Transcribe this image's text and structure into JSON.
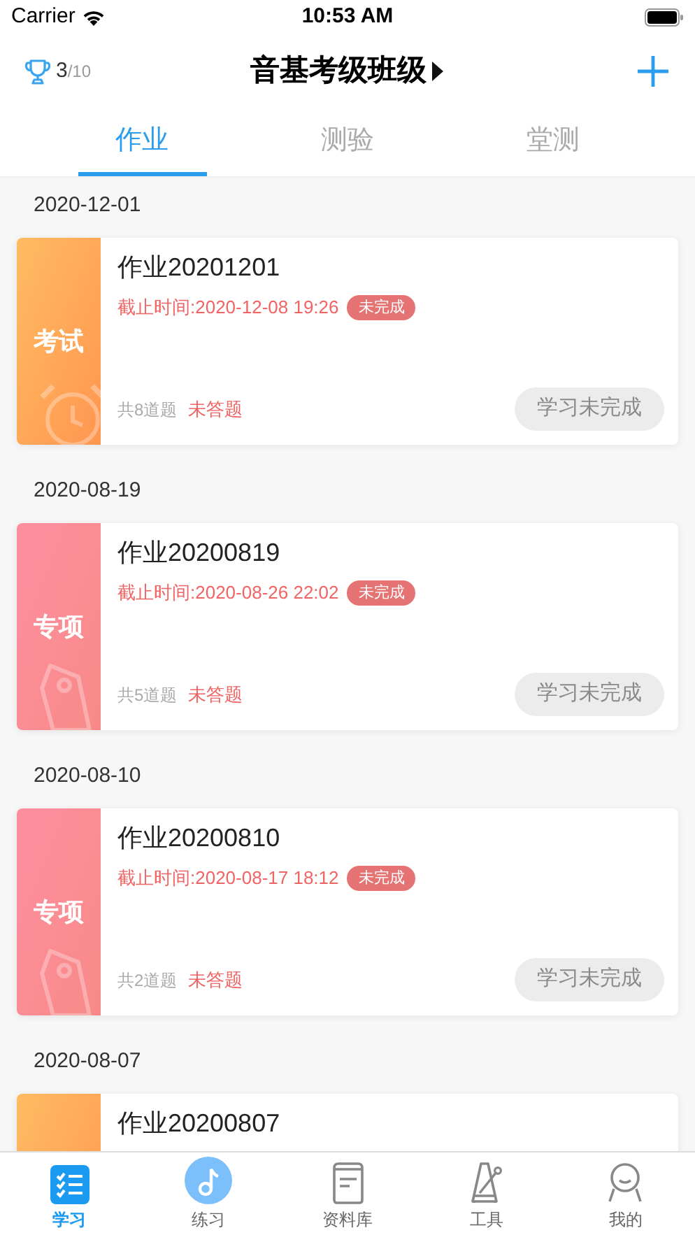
{
  "status_bar": {
    "carrier": "Carrier",
    "time": "10:53 AM"
  },
  "header": {
    "score": "3",
    "score_total": "/10",
    "title": "音基考级班级"
  },
  "tabs": [
    {
      "label": "作业",
      "selected": true
    },
    {
      "label": "测验",
      "selected": false
    },
    {
      "label": "堂测",
      "selected": false
    }
  ],
  "assignments": [
    {
      "date": "2020-12-01",
      "kind": "exam",
      "badge": "考试",
      "title": "作业20201201",
      "deadline": "截止时间:2020-12-08 19:26",
      "status": "未完成",
      "count": "共8道题",
      "answer_state": "未答题",
      "action": "学习未完成"
    },
    {
      "date": "2020-08-19",
      "kind": "special",
      "badge": "专项",
      "title": "作业20200819",
      "deadline": "截止时间:2020-08-26 22:02",
      "status": "未完成",
      "count": "共5道题",
      "answer_state": "未答题",
      "action": "学习未完成"
    },
    {
      "date": "2020-08-10",
      "kind": "special",
      "badge": "专项",
      "title": "作业20200810",
      "deadline": "截止时间:2020-08-17 18:12",
      "status": "未完成",
      "count": "共2道题",
      "answer_state": "未答题",
      "action": "学习未完成"
    },
    {
      "date": "2020-08-07",
      "kind": "exam",
      "title": "作业20200807"
    }
  ],
  "tab_bar": [
    {
      "label": "学习",
      "kind": "list",
      "selected": true
    },
    {
      "label": "练习",
      "kind": "note",
      "selected": false
    },
    {
      "label": "资料库",
      "kind": "book",
      "selected": false
    },
    {
      "label": "工具",
      "kind": "metronome",
      "selected": false
    },
    {
      "label": "我的",
      "kind": "person",
      "selected": false
    }
  ]
}
